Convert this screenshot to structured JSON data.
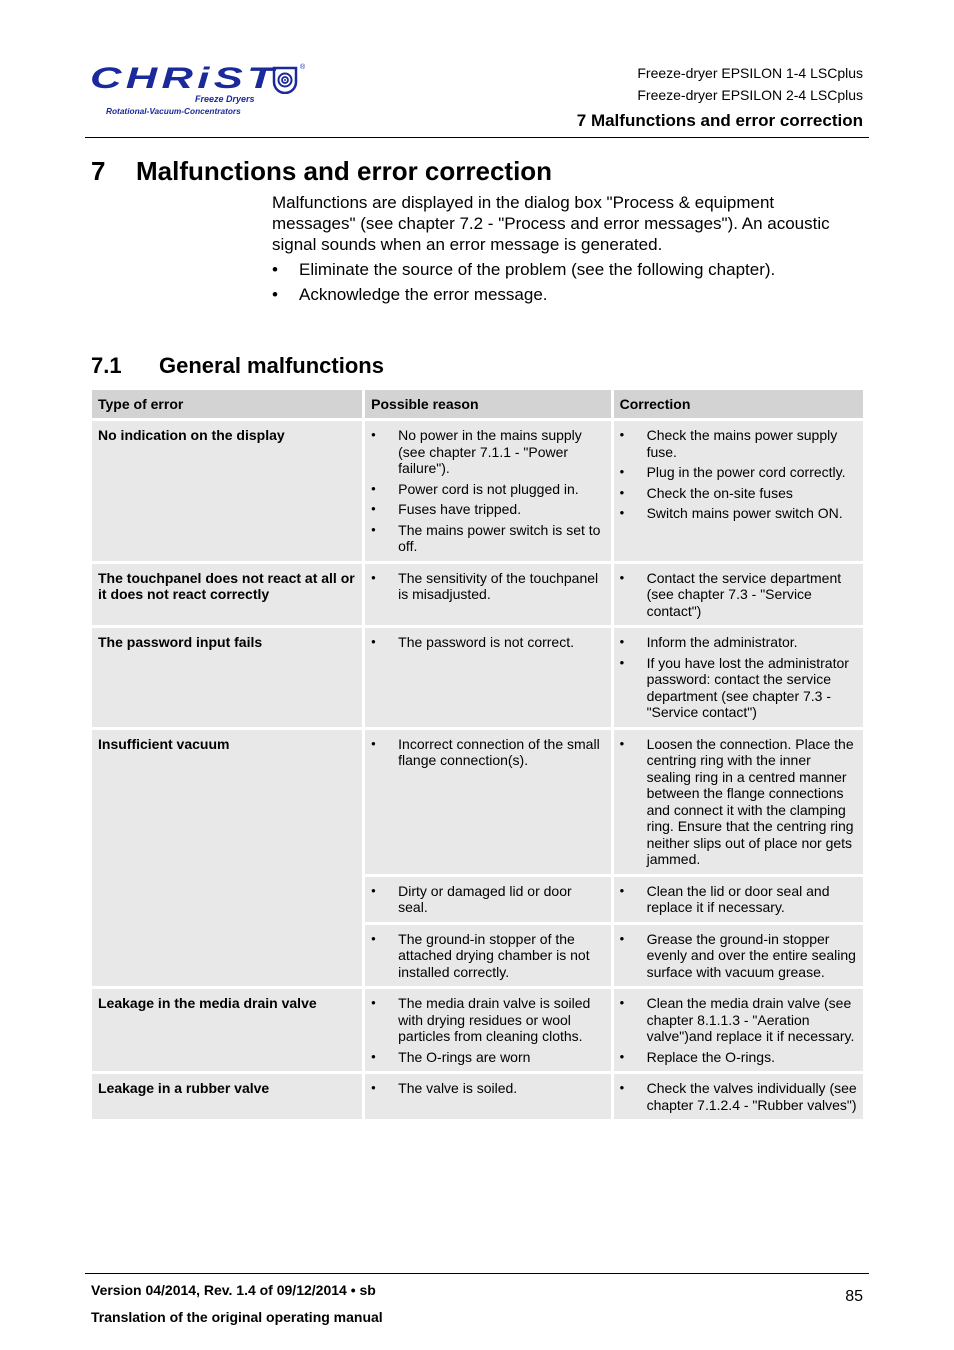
{
  "logo": {
    "brand": "CHRiST",
    "tagline_1": "Freeze Dryers",
    "tagline_2": "Rotational-Vacuum-Concentrators",
    "registered_mark": "®",
    "brand_color": "#1a2a9a"
  },
  "header": {
    "product_lines": [
      "Freeze-dryer EPSILON 1-4 LSCplus",
      "Freeze-dryer EPSILON 2-4 LSCplus"
    ],
    "chapter": "7 Malfunctions and error correction"
  },
  "chapter": {
    "number": "7",
    "title": "Malfunctions and error correction",
    "intro": "Malfunctions are displayed in the dialog box \"Process & equipment messages\" (see chapter 7.2 - \"Process and error messages\"). An acoustic signal sounds when an error message is generated.",
    "bullets": [
      "Eliminate the source of the problem (see the following chapter).",
      "Acknowledge the error message."
    ]
  },
  "section": {
    "number": "7.1",
    "title": "General malfunctions"
  },
  "table": {
    "headers": [
      "Type of error",
      "Possible reason",
      "Correction"
    ],
    "rows": [
      {
        "type": "No indication on the display",
        "reasons": [
          "No power in the mains supply (see chapter 7.1.1 - \"Power failure\").",
          "Power cord is not plugged in.",
          "Fuses have tripped.",
          "The mains power switch is set to off."
        ],
        "corrections": [
          "Check the mains power supply fuse.",
          "Plug in the power cord correctly.",
          "Check the on-site fuses",
          "Switch mains power switch ON."
        ]
      },
      {
        "type": "The touchpanel does not react at all or it does not react correctly",
        "reasons": [
          "The sensitivity of the touchpanel is misadjusted."
        ],
        "corrections": [
          "Contact the service department (see chapter 7.3 - \"Service contact\")"
        ]
      },
      {
        "type": "The password input fails",
        "reasons": [
          "The password is not correct."
        ],
        "corrections": [
          "Inform the administrator.",
          "If you have lost the administrator password: contact the service department (see chapter 7.3 - \"Service contact\")"
        ]
      },
      {
        "type": "Insufficient vacuum",
        "reasons": [
          "Incorrect connection of the small flange connection(s)."
        ],
        "corrections": [
          "Loosen the connection. Place the centring ring with the inner sealing ring in a centred manner between the flange connections and connect it with the clamping ring. Ensure that the centring ring neither slips out of place nor gets jammed."
        ]
      },
      {
        "type": "",
        "reasons": [
          "Dirty or damaged lid or door seal."
        ],
        "corrections": [
          "Clean the lid or door seal and replace it if necessary."
        ]
      },
      {
        "type": "",
        "reasons": [
          "The ground-in stopper of the attached drying chamber is not installed correctly."
        ],
        "corrections": [
          "Grease the ground-in stopper evenly and over the entire sealing surface with vacuum grease."
        ]
      },
      {
        "type": "Leakage in the media drain valve",
        "reasons": [
          "The media drain valve is soiled with drying residues or wool particles from cleaning cloths.",
          "The O-rings are worn"
        ],
        "corrections": [
          "Clean the media drain valve (see chapter 8.1.1.3 - \"Aeration valve\")and replace it if necessary.",
          "Replace the O-rings."
        ]
      },
      {
        "type": "Leakage in a rubber valve",
        "reasons": [
          "The valve is soiled."
        ],
        "corrections": [
          "Check the valves individually (see chapter 7.1.2.4 - \"Rubber valves\")"
        ]
      }
    ]
  },
  "footer": {
    "version": "Version 04/2014, Rev. 1.4 of 09/12/2014 • sb",
    "note": "Translation of the original operating manual",
    "page_number": "85"
  },
  "bullet_char": "•"
}
